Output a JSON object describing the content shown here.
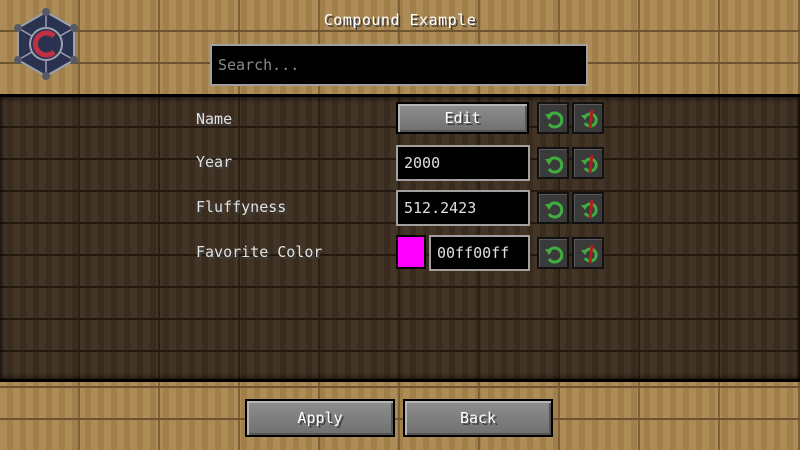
{
  "title": "Compound Example",
  "search": {
    "placeholder": "Search..."
  },
  "rows": [
    {
      "label": "Name",
      "button_label": "Edit"
    },
    {
      "label": "Year",
      "value": "2000"
    },
    {
      "label": "Fluffyness",
      "value": "512.2423"
    },
    {
      "label": "Favorite Color",
      "value": "00ff00ff",
      "swatch_color": "#ff00ff"
    }
  ],
  "icons": {
    "reset": "undo-arrow-icon",
    "default": "reset-default-icon",
    "logo": "configured-logo-icon"
  },
  "colors": {
    "reset_green": "#3fae3f",
    "default_red": "#b02020"
  },
  "footer": {
    "apply_label": "Apply",
    "back_label": "Back"
  }
}
